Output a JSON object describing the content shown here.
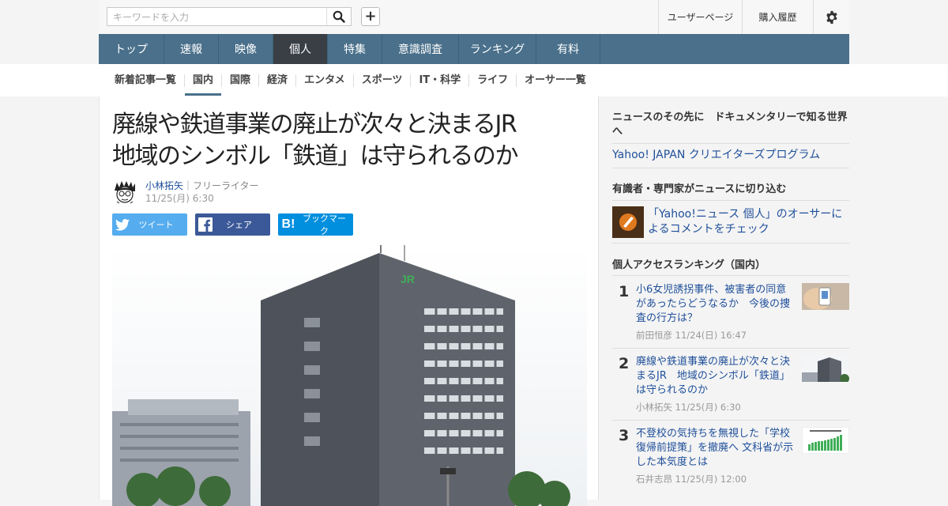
{
  "header": {
    "search_placeholder": "キーワードを入力",
    "user_page": "ユーザーページ",
    "purchase_history": "購入履歴",
    "icons": {
      "search": "search-icon",
      "plus": "plus-icon",
      "settings": "gear-icon"
    }
  },
  "nav": {
    "items": [
      {
        "label": "トップ"
      },
      {
        "label": "速報"
      },
      {
        "label": "映像"
      },
      {
        "label": "個人",
        "active": true
      },
      {
        "label": "特集"
      },
      {
        "label": "意識調査"
      },
      {
        "label": "ランキング"
      },
      {
        "label": "有料"
      }
    ]
  },
  "subnav": {
    "items": [
      {
        "label": "新着記事一覧"
      },
      {
        "label": "国内",
        "active": true
      },
      {
        "label": "国際"
      },
      {
        "label": "経済"
      },
      {
        "label": "エンタメ"
      },
      {
        "label": "スポーツ"
      },
      {
        "label": "IT・科学"
      },
      {
        "label": "ライフ"
      },
      {
        "label": "オーサー一覧"
      }
    ]
  },
  "article": {
    "title_line1": "廃線や鉄道事業の廃止が次々と決まるJR",
    "title_line2": "地域のシンボル「鉄道」は守られるのか",
    "author_name": "小林拓矢",
    "author_role": "｜フリーライター",
    "date": "11/25(月) 6:30",
    "share": {
      "tweet": "ツイート",
      "share": "シェア",
      "bookmark": "ブックマーク"
    }
  },
  "sidebar": {
    "promo_head": "ニュースのその先に　ドキュメンタリーで知る世界へ",
    "promo_link": "Yahoo! JAPAN クリエイターズプログラム",
    "expert_head": "有識者・専門家がニュースに切り込む",
    "expert_link": "「Yahoo!ニュース 個人」のオーサーによるコメントをチェック",
    "ranking_head": "個人アクセスランキング（国内）",
    "ranking": [
      {
        "rank": "1",
        "title": "小6女児誘拐事件、被害者の同意があったらどうなるか　今後の捜査の行方は？",
        "author": "前田恒彦",
        "date": "11/24(日) 16:47"
      },
      {
        "rank": "2",
        "title": "廃線や鉄道事業の廃止が次々と決まるJR　地域のシンボル「鉄道」は守られるのか",
        "author": "小林拓矢",
        "date": "11/25(月) 6:30"
      },
      {
        "rank": "3",
        "title": "不登校の気持ちを無視した「学校復帰前提策」を撤廃へ 文科省が示した本気度とは",
        "author": "石井志昂",
        "date": "11/25(月) 12:00"
      }
    ]
  },
  "colors": {
    "nav_bg": "#4a708b",
    "nav_active": "#3a3f45",
    "link": "#1f4f9a",
    "twitter": "#55acee",
    "facebook": "#3b5998",
    "hatena": "#008fde"
  }
}
